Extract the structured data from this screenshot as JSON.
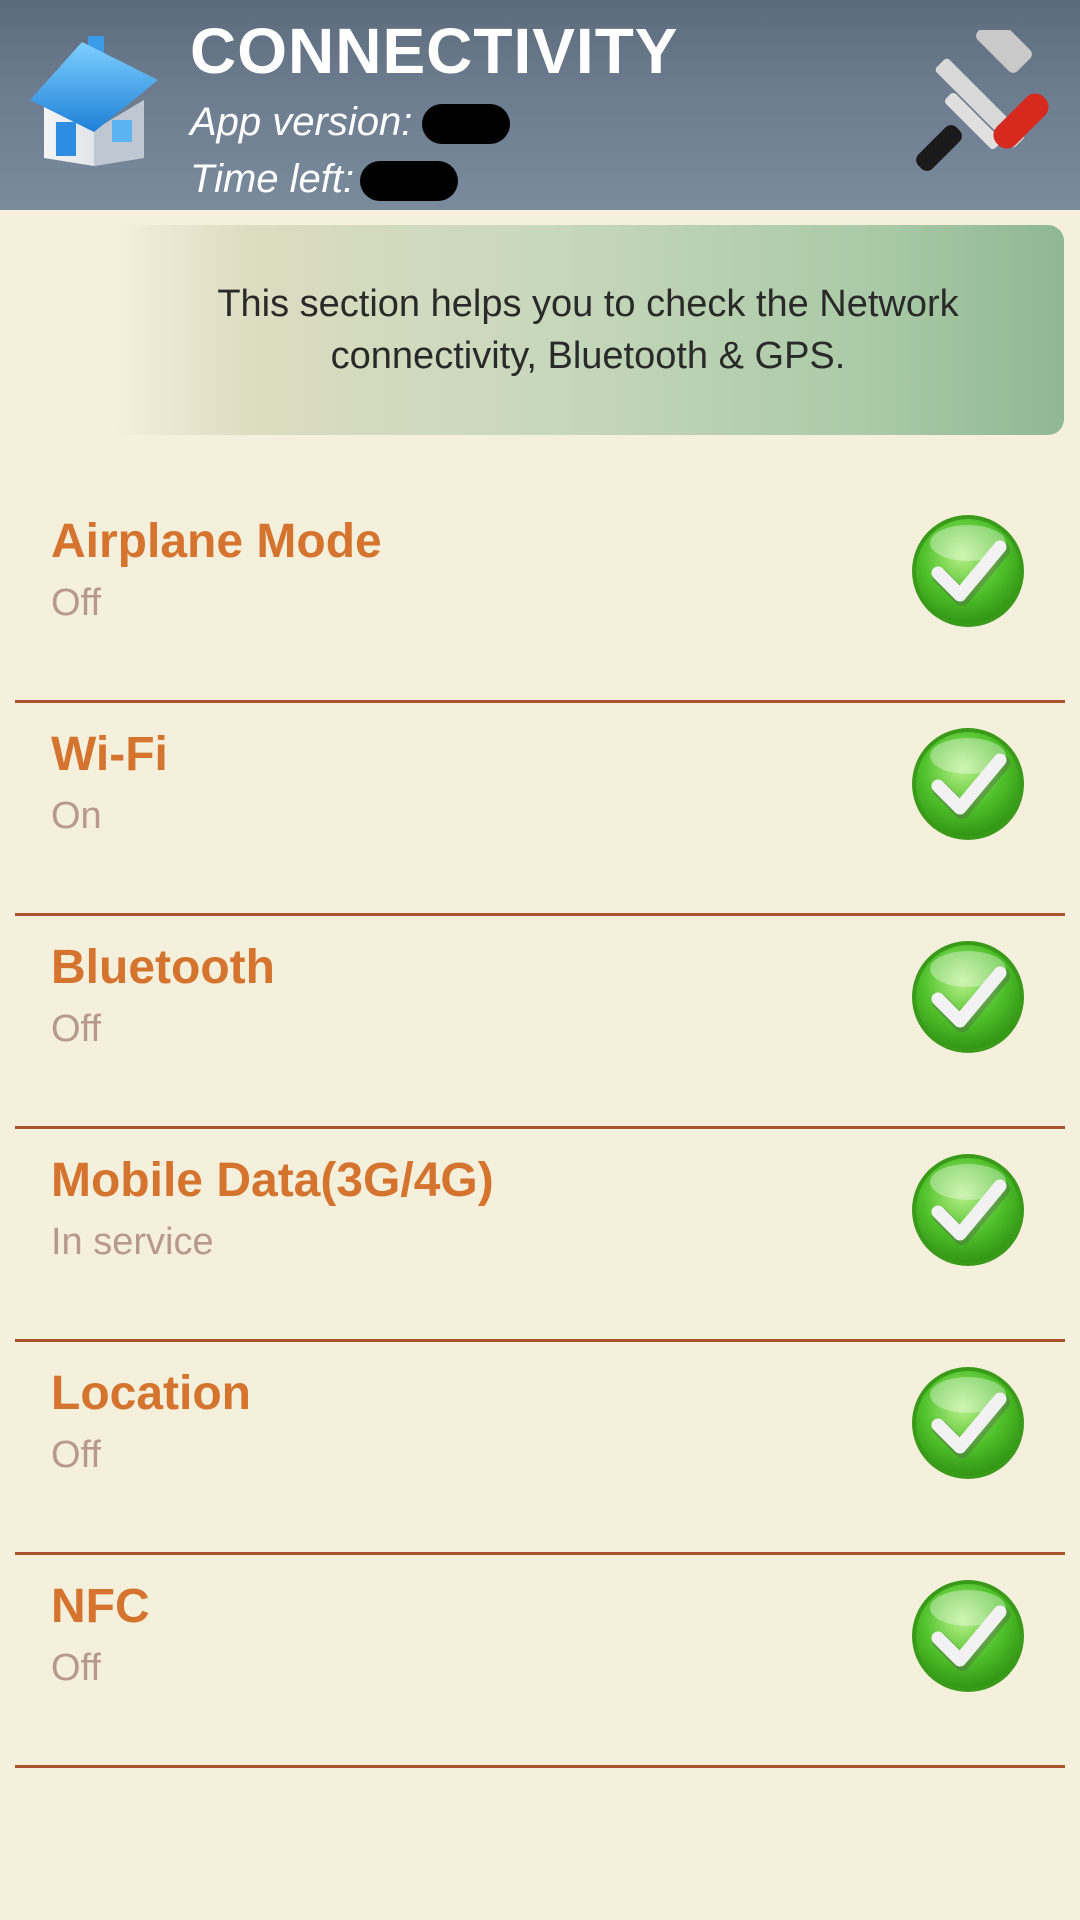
{
  "header": {
    "title": "CONNECTIVITY",
    "app_version_label": "App version:",
    "time_left_label": "Time left:",
    "home_icon": "home-icon",
    "tools_icon": "tools-icon"
  },
  "info": {
    "text": "This section helps you to check the Network connectivity, Bluetooth & GPS."
  },
  "colors": {
    "header": "#6d7d8f",
    "background": "#f4f0dc",
    "item_title": "#d5742e",
    "divider": "#a9542e",
    "check": "#4fc12a"
  },
  "items": [
    {
      "title": "Airplane Mode",
      "status": "Off",
      "icon": "check-icon"
    },
    {
      "title": "Wi-Fi",
      "status": "On",
      "icon": "check-icon"
    },
    {
      "title": "Bluetooth",
      "status": "Off",
      "icon": "check-icon"
    },
    {
      "title": "Mobile Data(3G/4G)",
      "status": "In service",
      "icon": "check-icon"
    },
    {
      "title": "Location",
      "status": "Off",
      "icon": "check-icon"
    },
    {
      "title": "NFC",
      "status": "Off",
      "icon": "check-icon"
    }
  ]
}
